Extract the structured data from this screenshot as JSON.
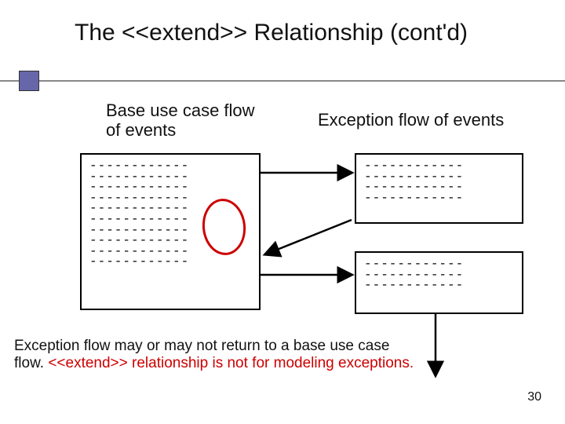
{
  "title": "The <<extend>> Relationship (cont'd)",
  "labels": {
    "left": "Base use case flow\nof events",
    "right": "Exception flow of events"
  },
  "boxes": {
    "left_lines": "------------\n------------\n------------\n------------\n------------\n------------\n------------\n------------\n------------\n------------",
    "top_right_lines": "------------\n------------\n------------\n------------",
    "bot_right_lines": "------------\n------------\n------------"
  },
  "caption_pre": "Exception flow may or may not return to a base use case flow. ",
  "caption_red": "<<extend>> relationship is not for modeling exceptions.",
  "page_number": "30"
}
